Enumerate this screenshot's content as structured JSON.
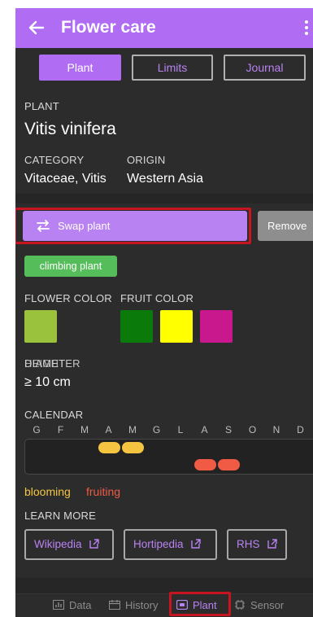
{
  "app_bar": {
    "title": "Flower care",
    "back_icon": "arrow-left-icon",
    "more_icon": "more-vertical-icon"
  },
  "tabs": [
    {
      "label": "Plant",
      "active": true
    },
    {
      "label": "Limits",
      "active": false
    },
    {
      "label": "Journal",
      "active": false
    }
  ],
  "plant": {
    "section_label": "PLANT",
    "name": "Vitis vinifera",
    "category_label": "CATEGORY",
    "category": "Vitaceae, Vitis",
    "origin_label": "ORIGIN",
    "origin": "Western Asia"
  },
  "actions": {
    "swap_label": "Swap plant",
    "swap_icon": "swap-horizontal-icon",
    "remove_label": "Remove"
  },
  "tag": {
    "label": "climbing plant",
    "color": "#55be5a"
  },
  "colors": {
    "flower_label": "FLOWER COLOR",
    "fruit_label": "FRUIT COLOR",
    "flower": [
      "#9ac23c"
    ],
    "fruit": [
      "#0a7a0a",
      "#ffff00",
      "#c9188e"
    ]
  },
  "size": {
    "label": "DIAMETER",
    "overlay_label": "HEIGHT",
    "value": "≥ 10 cm"
  },
  "calendar": {
    "label": "CALENDAR",
    "months": [
      "G",
      "F",
      "M",
      "A",
      "M",
      "G",
      "L",
      "A",
      "S",
      "O",
      "N",
      "D"
    ],
    "blooming": {
      "label": "blooming",
      "color": "#f5c542",
      "months": [
        4,
        5
      ]
    },
    "fruiting": {
      "label": "fruiting",
      "color": "#ef5b45",
      "months": [
        8,
        9
      ]
    }
  },
  "learn_more": {
    "label": "LEARN MORE",
    "links": [
      {
        "label": "Wikipedia",
        "icon": "external-link-icon"
      },
      {
        "label": "Hortipedia",
        "icon": "external-link-icon"
      },
      {
        "label": "RHS",
        "icon": "external-link-icon"
      }
    ]
  },
  "bottom_nav": [
    {
      "label": "Data",
      "icon": "bar-chart-icon",
      "active": false
    },
    {
      "label": "History",
      "icon": "calendar-icon",
      "active": false
    },
    {
      "label": "Plant",
      "icon": "plant-card-icon",
      "active": true
    },
    {
      "label": "Sensor",
      "icon": "chip-icon",
      "active": false
    }
  ],
  "accent_color": "#b06cf2",
  "highlight_color": "#c61420"
}
